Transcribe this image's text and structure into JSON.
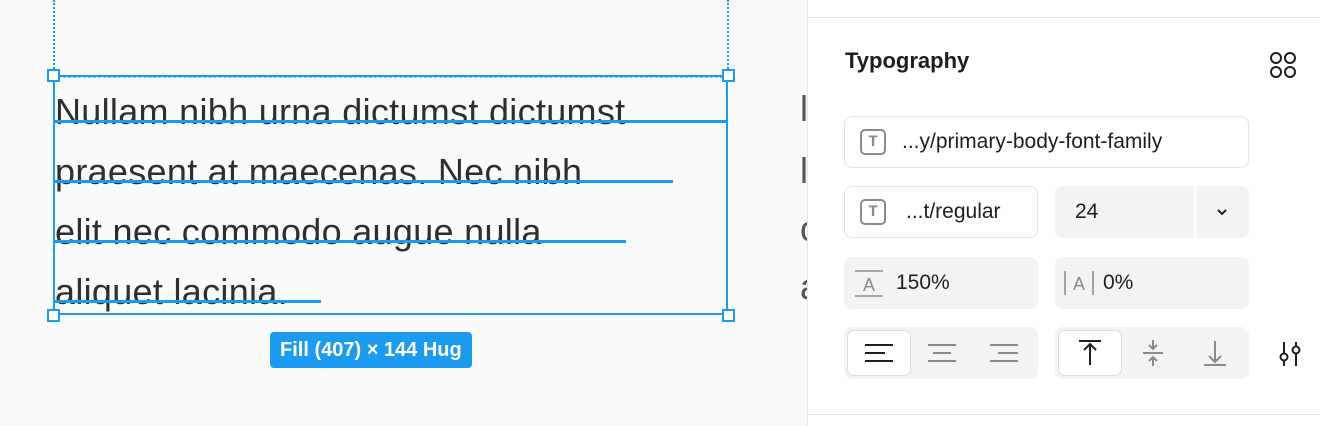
{
  "canvas": {
    "paragraph_lines": [
      "Nullam nibh urna dictumst dictumst",
      "praesent at maecenas. Nec nibh",
      "elit nec commodo augue nulla",
      "aliquet lacinia."
    ],
    "dimension_label": "Fill (407) × 144 Hug",
    "peek_letters": [
      "l",
      "l",
      "c",
      "a"
    ]
  },
  "typography": {
    "title": "Typography",
    "font_family": "...y/primary-body-font-family",
    "font_weight": "...t/regular",
    "font_size": "24",
    "line_height": "150%",
    "letter_spacing": "0%",
    "text_align": {
      "options": [
        "left",
        "center",
        "right"
      ],
      "selected": "left"
    },
    "vertical_align": {
      "options": [
        "top",
        "middle",
        "bottom"
      ],
      "selected": "top"
    }
  },
  "colors": {
    "selection": "#1b9bf0",
    "panel_bg": "#ffffff",
    "canvas_bg": "#fafafa"
  }
}
